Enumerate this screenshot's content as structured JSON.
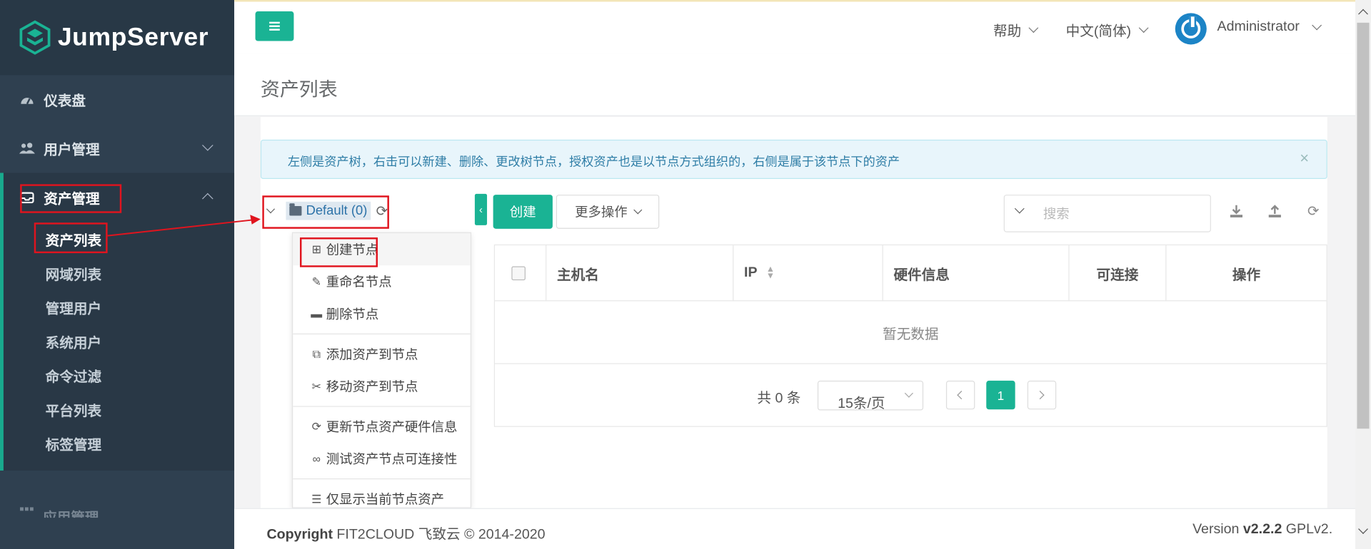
{
  "sidebar": {
    "logo_text": "JumpServer",
    "nav": [
      {
        "label": "仪表盘",
        "icon": "dashboard-icon"
      },
      {
        "label": "用户管理",
        "icon": "users-icon"
      }
    ],
    "active_group": {
      "label": "资产管理",
      "icon": "inbox-icon"
    },
    "sub_items": [
      "资产列表",
      "网域列表",
      "管理用户",
      "系统用户",
      "命令过滤",
      "平台列表",
      "标签管理"
    ],
    "next_group": {
      "label": "应用管理",
      "icon": "grid-icon"
    }
  },
  "topbar": {
    "help": "帮助",
    "language": "中文(简体)",
    "user": "Administrator"
  },
  "page": {
    "title": "资产列表",
    "alert": "左侧是资产树，右击可以新建、删除、更改树节点，授权资产也是以节点方式组织的，右侧是属于该节点下的资产",
    "alert_close": "×"
  },
  "tree": {
    "root_label": "Default (0)"
  },
  "context_menu": {
    "groups": [
      [
        "创建节点",
        "重命名节点",
        "删除节点"
      ],
      [
        "添加资产到节点",
        "移动资产到节点"
      ],
      [
        "更新节点资产硬件信息",
        "测试资产节点可连接性"
      ],
      [
        "仅显示当前节点资产"
      ]
    ]
  },
  "toolbar": {
    "create": "创建",
    "more": "更多操作",
    "search_placeholder": "搜索"
  },
  "table": {
    "columns": [
      "主机名",
      "IP",
      "硬件信息",
      "可连接",
      "操作"
    ],
    "empty": "暂无数据",
    "total": "共 0 条",
    "page_size": "15条/页",
    "current_page": "1"
  },
  "footer": {
    "copyright_label": "Copyright",
    "copyright_text": "FIT2CLOUD 飞致云 © 2014-2020",
    "version_label": "Version",
    "version": "v2.2.2",
    "license": "GPLv2."
  },
  "colors": {
    "sidebar_bg": "#2f4050",
    "accent": "#1ab394",
    "annotation": "#e0141e"
  }
}
